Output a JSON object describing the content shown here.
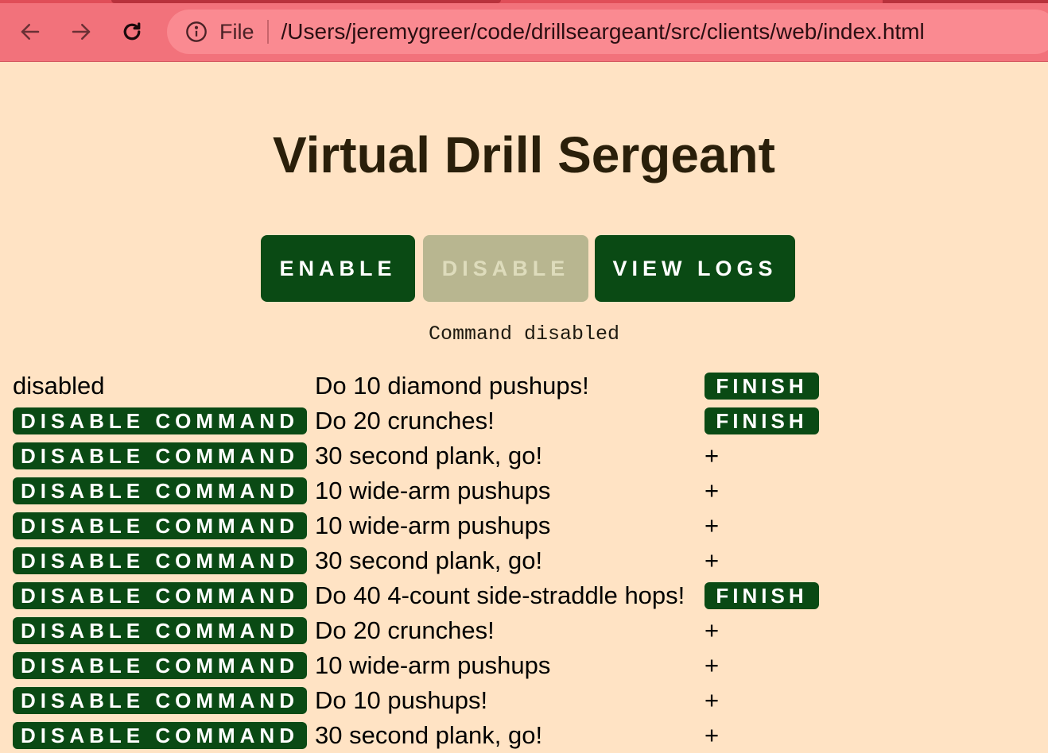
{
  "browser": {
    "scheme": "File",
    "url": "/Users/jeremygreer/code/drillseargeant/src/clients/web/index.html"
  },
  "page": {
    "title": "Virtual Drill Sergeant",
    "buttons": {
      "enable": "ENABLE",
      "disable": "DISABLE",
      "view_logs": "VIEW LOGS"
    },
    "status": "Command disabled"
  },
  "commands": [
    {
      "state": "disabled",
      "text": "Do 10 diamond pushups!",
      "action": "FINISH"
    },
    {
      "state": "DISABLE COMMAND",
      "text": "Do 20 crunches!",
      "action": "FINISH"
    },
    {
      "state": "DISABLE COMMAND",
      "text": "30 second plank, go!",
      "action": "+"
    },
    {
      "state": "DISABLE COMMAND",
      "text": "10 wide-arm pushups",
      "action": "+"
    },
    {
      "state": "DISABLE COMMAND",
      "text": "10 wide-arm pushups",
      "action": "+"
    },
    {
      "state": "DISABLE COMMAND",
      "text": "30 second plank, go!",
      "action": "+"
    },
    {
      "state": "DISABLE COMMAND",
      "text": "Do 40 4-count side-straddle hops!",
      "action": "FINISH"
    },
    {
      "state": "DISABLE COMMAND",
      "text": "Do 20 crunches!",
      "action": "+"
    },
    {
      "state": "DISABLE COMMAND",
      "text": "10 wide-arm pushups",
      "action": "+"
    },
    {
      "state": "DISABLE COMMAND",
      "text": "Do 10 pushups!",
      "action": "+"
    },
    {
      "state": "DISABLE COMMAND",
      "text": "30 second plank, go!",
      "action": "+"
    }
  ],
  "colors": {
    "page_bg": "#ffe3c4",
    "button_green": "#0a4a14",
    "button_disabled": "#b8b690",
    "browser_bar": "#f2727b"
  }
}
